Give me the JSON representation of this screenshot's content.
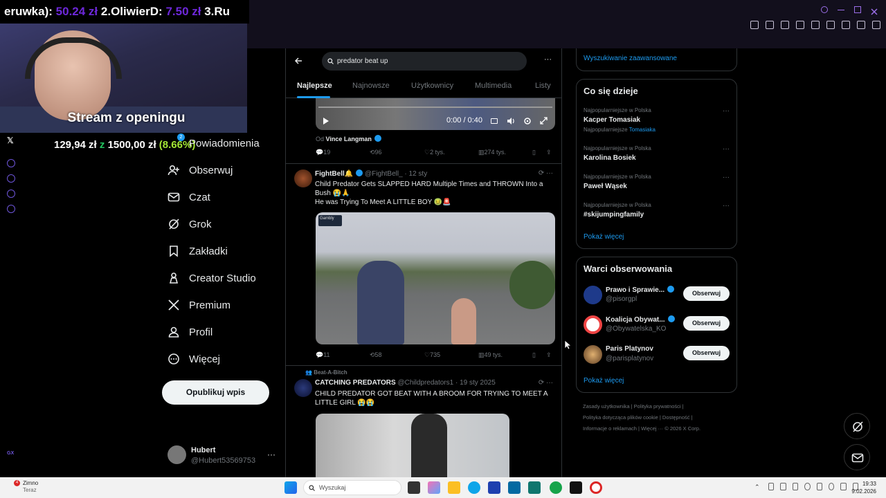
{
  "stream": {
    "ticker_prefix": "eruwka):",
    "ticker_amount_1": "50.24 zł",
    "ticker_mid": "2.OliwierD:",
    "ticker_amount_2": "7.50 zł",
    "ticker_suffix": "3.Ru",
    "title": "Stream z openingu",
    "goal_current": "129,94 zł",
    "goal_z": "z",
    "goal_target": "1500,00 zł",
    "goal_pct": "(8.66%)"
  },
  "nav": {
    "items": [
      {
        "label": "Powiadomienia",
        "badge": "2"
      },
      {
        "label": "Obserwuj"
      },
      {
        "label": "Czat"
      },
      {
        "label": "Grok"
      },
      {
        "label": "Zakładki"
      },
      {
        "label": "Creator Studio"
      },
      {
        "label": "Premium"
      },
      {
        "label": "Profil"
      },
      {
        "label": "Więcej"
      }
    ],
    "post_button": "Opublikuj wpis",
    "profile_name": "Hubert",
    "profile_handle": "@Hubert53569753",
    "profile_more": "···"
  },
  "search": {
    "query": "predator beat up",
    "more": "···"
  },
  "tabs": [
    "Najlepsze",
    "Najnowsze",
    "Użytkownicy",
    "Multimedia",
    "Listy"
  ],
  "tweets": [
    {
      "video_time": "0:00 / 0:40",
      "from_label": "Od",
      "from_name": "Vince Langman",
      "replies": "19",
      "reposts": "96",
      "likes": "2 tys.",
      "views": "274 tys."
    },
    {
      "name": "FightBell🔔",
      "handle": "@FightBell_ · 12 sty",
      "text_1": "Child Predator Gets SLAPPED HARD Multiple Times and THROWN Into a Bush 😭🙏",
      "text_2": "He was Trying To Meet A LITTLE BOY 🤢🚨",
      "watermark": "Gambly",
      "replies": "11",
      "reposts": "58",
      "likes": "735",
      "views": "49 tys."
    },
    {
      "context": "Beat-A-Bitch",
      "name": "CATCHING PREDATORS",
      "handle": "@Childpredators1 · 19 sty 2025",
      "text": "CHILD PREDATOR GOT BEAT WITH A BROOM FOR TRYING TO MEET A LITTLE GIRL 😭😭"
    }
  ],
  "right": {
    "advanced_search": "Wyszukiwanie zaawansowane",
    "trends_title": "Co się dzieje",
    "trends": [
      {
        "context": "Najpopularniejsze w Polska",
        "name": "Kacper Tomasiak",
        "extra_label": "Najpopularniejsze",
        "extra_link": "Tomasiaka"
      },
      {
        "context": "Najpopularniejsze w Polska",
        "name": "Karolina Bosiek"
      },
      {
        "context": "Najpopularniejsze w Polska",
        "name": "Paweł Wąsek"
      },
      {
        "context": "Najpopularniejsze w Polska",
        "name": "#skijumpingfamily"
      }
    ],
    "show_more": "Pokaż więcej",
    "who_title": "Warci obserwowania",
    "suggestions": [
      {
        "name": "Prawo i Sprawie...",
        "handle": "@pisorgpl",
        "button": "Obserwuj"
      },
      {
        "name": "Koalicja Obywat...",
        "handle": "@Obywatelska_KO",
        "button": "Obserwuj"
      },
      {
        "name": "Paris Platynov",
        "handle": "@parisplatynov",
        "button": "Obserwuj"
      }
    ],
    "show_more_2": "Pokaż więcej",
    "footer_line_1": "Zasady użytkownika   |   Polityka prywatności   |",
    "footer_line_2": "Polityka dotycząca plików cookie   |   Dostępność   |",
    "footer_line_3": "Informacje o reklamach   |   Więcej ···   © 2026 X Corp."
  },
  "taskbar": {
    "weather_badge": "4",
    "weather_label": "Zimno",
    "weather_sub": "Teraz",
    "search_placeholder": "Wyszukaj",
    "time": "19:33",
    "date": "9.02.2026"
  }
}
